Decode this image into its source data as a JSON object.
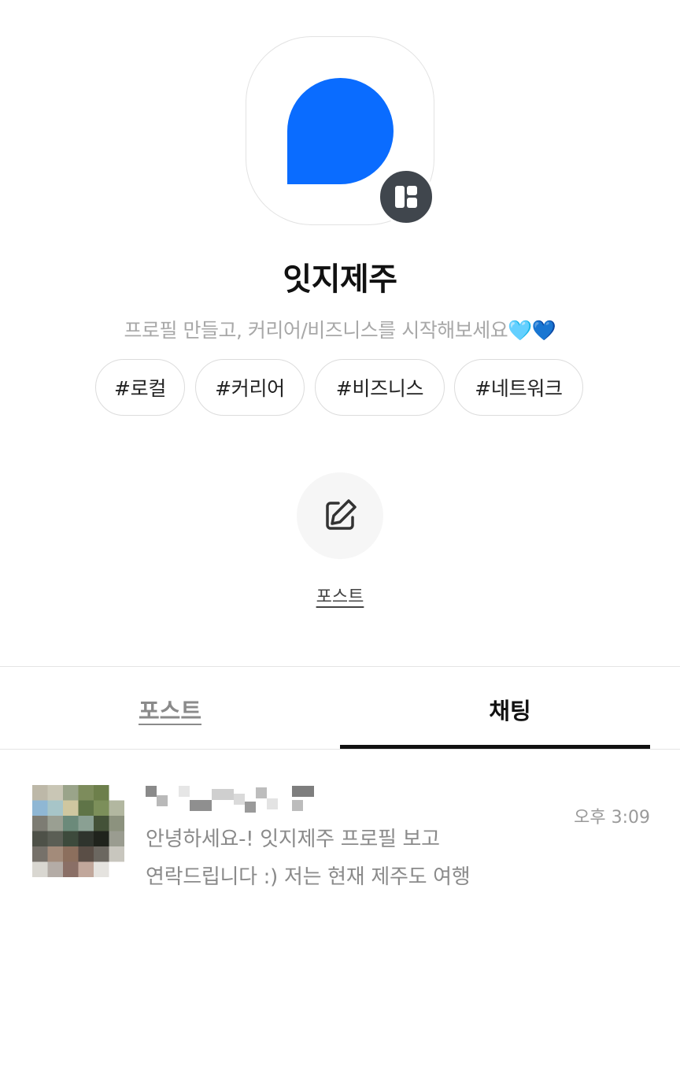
{
  "profile": {
    "name": "잇지제주",
    "description": "프로필 만들고, 커리어/비즈니스를 시작해보세요🩵💙",
    "tags": [
      "#로컬",
      "#커리어",
      "#비즈니스",
      "#네트워크"
    ],
    "logo_color": "#0A6CFF",
    "badge_color": "#40464D"
  },
  "actions": {
    "post_label": "포스트"
  },
  "tabs": [
    {
      "label": "포스트",
      "active": false
    },
    {
      "label": "채팅",
      "active": true
    }
  ],
  "chats": [
    {
      "sender_name": "",
      "preview_line1": "안녕하세요-! 잇지제주 프로필 보고",
      "preview_line2": "연락드립니다 :) 저는 현재 제주도 여행",
      "time": "오후 3:09"
    }
  ]
}
